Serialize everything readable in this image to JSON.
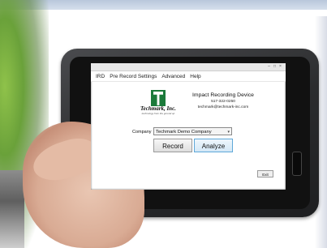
{
  "menu": {
    "items": [
      "IRD",
      "Pre Record Settings",
      "Advanced",
      "Help"
    ]
  },
  "logo": {
    "name": "Techmark, Inc.",
    "tagline": "technology from the ground up"
  },
  "device": {
    "title": "Impact Recording Device",
    "phone": "517-322-0250",
    "email": "techmark@techmark-inc.com"
  },
  "company": {
    "label": "Company",
    "selected": "Techmark Demo Company"
  },
  "buttons": {
    "record": "Record",
    "analyze": "Analyze",
    "exit": "Exit"
  },
  "colors": {
    "logo_green": "#1b7a3a",
    "analyze_focus": "#5fa8d8"
  }
}
